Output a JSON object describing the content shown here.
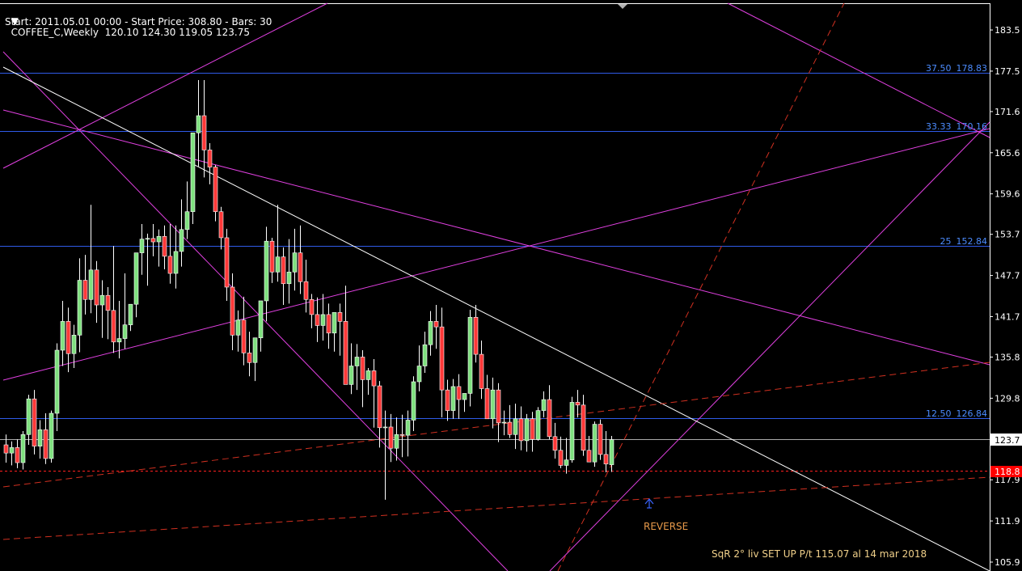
{
  "header": {
    "symbol_line": "COFFEE_C,Weekly  120.10 124.30 119.05 123.75",
    "info_line": "Start: 2011.05.01 00:00 - Start Price: 308.80 - Bars: 30"
  },
  "price_axis": {
    "ticks": [
      "183.5",
      "177.5",
      "171.6",
      "165.6",
      "159.6",
      "153.7",
      "147.7",
      "141.7",
      "135.8",
      "129.8",
      "123.7",
      "117.9",
      "111.9",
      "105.9"
    ],
    "tick_values": [
      183.5,
      177.5,
      171.6,
      165.6,
      159.6,
      153.7,
      147.7,
      141.7,
      135.8,
      129.8,
      123.7,
      117.9,
      111.9,
      105.9
    ],
    "current_price_label": "123.7",
    "current_price": 123.75,
    "alert_price_label": "118.8",
    "alert_price": 118.8,
    "range": [
      104.6,
      187.4
    ]
  },
  "fib_levels": [
    {
      "pct": "37.50",
      "value": "178.83",
      "price": 178.83
    },
    {
      "pct": "33.33",
      "value": "170.16",
      "price": 170.16
    },
    {
      "pct": "25",
      "value": "152.84",
      "price": 152.84
    },
    {
      "pct": "12.50",
      "value": "126.84",
      "price": 126.84
    }
  ],
  "annotations": {
    "reverse_label": "REVERSE",
    "setup_label": "SqR 2° liv SET UP P/t 115.07 al 14 mar  2018"
  },
  "colors": {
    "background": "#000000",
    "bull_candle": "#7fe07f",
    "bear_candle": "#ff3838",
    "fib_line": "#2f5be8",
    "fib_text": "#4c8cff",
    "magenta_lines": "#e040e0",
    "trend_line": "#ffffff",
    "dashed_lines": "#d03020",
    "price_label_bg": "#ffffff",
    "alert_label_bg": "#ff0000",
    "reverse_text": "#e89a4a",
    "arrow": "#3a64ff"
  },
  "chart_data": {
    "type": "candlestick",
    "candles": [
      [
        123.0,
        124.5,
        120.4,
        121.8
      ],
      [
        121.8,
        123.5,
        120.0,
        122.6
      ],
      [
        122.6,
        123.8,
        119.6,
        120.4
      ],
      [
        120.4,
        125.0,
        119.4,
        124.5
      ],
      [
        124.5,
        130.3,
        123.0,
        129.7
      ],
      [
        129.7,
        131.0,
        121.6,
        122.8
      ],
      [
        122.8,
        126.6,
        121.0,
        125.2
      ],
      [
        125.2,
        127.6,
        120.2,
        121.0
      ],
      [
        121.0,
        128.0,
        120.4,
        127.6
      ],
      [
        127.6,
        137.8,
        125.0,
        136.8
      ],
      [
        136.8,
        144.0,
        134.5,
        141.0
      ],
      [
        141.0,
        143.0,
        133.6,
        136.3
      ],
      [
        136.3,
        140.5,
        134.2,
        139.0
      ],
      [
        139.0,
        150.2,
        136.5,
        147.0
      ],
      [
        147.0,
        150.7,
        142.0,
        144.2
      ],
      [
        144.2,
        158.0,
        142.2,
        148.5
      ],
      [
        148.5,
        149.8,
        140.8,
        143.4
      ],
      [
        143.4,
        147.0,
        138.6,
        144.8
      ],
      [
        144.8,
        146.0,
        138.4,
        142.6
      ],
      [
        142.6,
        152.0,
        136.4,
        138.0
      ],
      [
        138.0,
        144.0,
        135.6,
        138.5
      ],
      [
        138.5,
        148.0,
        137.0,
        140.5
      ],
      [
        140.5,
        143.0,
        139.6,
        143.5
      ],
      [
        143.5,
        146.2,
        141.6,
        151.0
      ],
      [
        151.0,
        155.2,
        147.8,
        153.0
      ],
      [
        153.0,
        153.8,
        146.2,
        153.1
      ],
      [
        153.1,
        155.2,
        150.5,
        152.6
      ],
      [
        152.6,
        154.4,
        149.0,
        153.4
      ],
      [
        153.4,
        155.0,
        148.6,
        150.5
      ],
      [
        150.5,
        155.2,
        146.5,
        148.0
      ],
      [
        148.0,
        155.0,
        145.8,
        151.2
      ],
      [
        151.2,
        158.8,
        149.0,
        154.4
      ],
      [
        154.4,
        161.4,
        153.0,
        157.0
      ],
      [
        157.0,
        163.8,
        155.2,
        168.5
      ],
      [
        168.5,
        176.2,
        163.6,
        171.0
      ],
      [
        171.0,
        176.2,
        162.0,
        166.0
      ],
      [
        166.0,
        167.0,
        161.0,
        163.5
      ],
      [
        163.5,
        163.8,
        155.6,
        157.0
      ],
      [
        157.0,
        157.7,
        151.5,
        153.2
      ],
      [
        153.2,
        154.5,
        144.0,
        146.0
      ],
      [
        146.0,
        148.0,
        136.8,
        139.0
      ],
      [
        139.0,
        142.6,
        136.6,
        141.2
      ],
      [
        141.2,
        144.6,
        134.6,
        136.4
      ],
      [
        136.4,
        139.5,
        133.0,
        135.0
      ],
      [
        135.0,
        137.3,
        132.3,
        138.6
      ],
      [
        138.6,
        140.4,
        136.6,
        144.0
      ],
      [
        144.0,
        154.8,
        141.0,
        152.7
      ],
      [
        152.7,
        153.2,
        146.6,
        148.2
      ],
      [
        148.2,
        158.0,
        146.8,
        150.4
      ],
      [
        150.4,
        151.8,
        143.4,
        146.5
      ],
      [
        146.5,
        153.0,
        143.6,
        148.2
      ],
      [
        148.2,
        154.5,
        145.5,
        151.0
      ],
      [
        151.0,
        155.0,
        145.0,
        146.8
      ],
      [
        146.8,
        150.0,
        142.3,
        144.2
      ],
      [
        144.2,
        145.0,
        140.0,
        142.0
      ],
      [
        142.0,
        144.5,
        138.0,
        140.4
      ],
      [
        140.4,
        145.0,
        138.2,
        142.0
      ],
      [
        142.0,
        143.6,
        137.0,
        139.3
      ],
      [
        139.3,
        141.5,
        136.6,
        142.3
      ],
      [
        142.3,
        143.6,
        136.0,
        141.0
      ],
      [
        141.0,
        146.2,
        136.8,
        131.8
      ],
      [
        131.8,
        137.8,
        130.4,
        134.5
      ],
      [
        134.5,
        137.7,
        131.0,
        135.8
      ],
      [
        135.8,
        136.8,
        128.5,
        132.5
      ],
      [
        132.5,
        134.2,
        130.3,
        133.8
      ],
      [
        133.8,
        135.5,
        125.5,
        131.6
      ],
      [
        131.6,
        132.3,
        122.6,
        125.5
      ],
      [
        125.5,
        128.0,
        115.0,
        125.6
      ],
      [
        125.6,
        127.5,
        120.5,
        122.5
      ],
      [
        122.5,
        127.0,
        120.7,
        124.5
      ],
      [
        124.5,
        127.4,
        121.2,
        124.4
      ],
      [
        124.4,
        128.0,
        121.3,
        126.6
      ],
      [
        126.6,
        133.0,
        125.0,
        132.2
      ],
      [
        132.2,
        137.5,
        130.8,
        134.5
      ],
      [
        134.5,
        139.5,
        133.5,
        137.6
      ],
      [
        137.6,
        142.5,
        136.0,
        141.0
      ],
      [
        141.0,
        143.4,
        137.0,
        140.2
      ],
      [
        140.2,
        143.0,
        127.0,
        131.0
      ],
      [
        131.0,
        132.5,
        126.5,
        128.0
      ],
      [
        128.0,
        132.6,
        126.8,
        131.5
      ],
      [
        131.5,
        133.3,
        126.8,
        129.6
      ],
      [
        129.6,
        130.5,
        127.8,
        130.5
      ],
      [
        130.5,
        142.7,
        128.6,
        141.6
      ],
      [
        141.6,
        143.4,
        135.0,
        136.2
      ],
      [
        136.2,
        138.2,
        129.7,
        131.2
      ],
      [
        131.2,
        133.2,
        126.8,
        126.8
      ],
      [
        126.8,
        132.8,
        125.4,
        131.0
      ],
      [
        131.0,
        132.0,
        123.4,
        126.2
      ],
      [
        126.2,
        128.0,
        124.4,
        126.3
      ],
      [
        126.3,
        128.8,
        124.0,
        124.5
      ],
      [
        124.5,
        129.0,
        122.4,
        126.8
      ],
      [
        126.8,
        128.6,
        122.2,
        123.6
      ],
      [
        123.6,
        127.5,
        122.0,
        126.8
      ],
      [
        126.8,
        127.8,
        122.0,
        123.8
      ],
      [
        123.8,
        128.5,
        123.6,
        128.0
      ],
      [
        128.0,
        130.8,
        127.0,
        129.6
      ],
      [
        129.6,
        131.7,
        123.8,
        124.2
      ],
      [
        124.2,
        126.2,
        121.0,
        122.2
      ],
      [
        122.2,
        124.2,
        119.6,
        120.0
      ],
      [
        120.0,
        124.0,
        118.8,
        120.8
      ],
      [
        120.8,
        130.0,
        120.4,
        129.2
      ],
      [
        129.2,
        131.0,
        127.0,
        128.8
      ],
      [
        128.8,
        130.3,
        121.4,
        122.2
      ],
      [
        122.2,
        124.3,
        120.5,
        120.5
      ],
      [
        120.5,
        126.4,
        119.8,
        126.0
      ],
      [
        126.0,
        126.7,
        120.8,
        121.6
      ],
      [
        121.6,
        125.0,
        119.0,
        120.2
      ],
      [
        120.1,
        124.3,
        119.05,
        123.75
      ]
    ]
  }
}
